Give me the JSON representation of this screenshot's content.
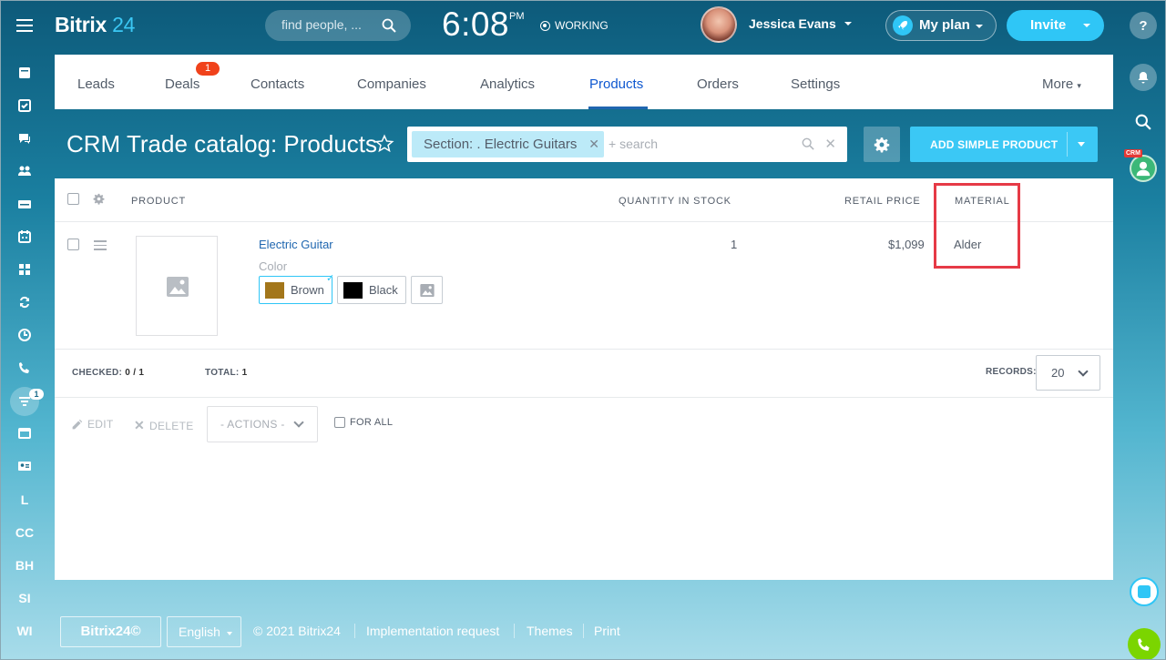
{
  "header": {
    "logo_text": "Bitrix",
    "logo_num": "24",
    "search_placeholder": "find people, ...",
    "time": "6:08",
    "ampm": "PM",
    "status": "WORKING",
    "user_name": "Jessica Evans",
    "myplan_label": "My plan",
    "invite_label": "Invite"
  },
  "left_sidebar": {
    "text_items": [
      "L",
      "CC",
      "BH",
      "SI",
      "WI"
    ],
    "badge": "1"
  },
  "right_sidebar": {
    "help": "?",
    "crm_tag": "CRM"
  },
  "nav": {
    "items": [
      "Leads",
      "Deals",
      "Contacts",
      "Companies",
      "Analytics",
      "Products",
      "Orders",
      "Settings"
    ],
    "active": "Products",
    "deals_badge": "1",
    "more_label": "More"
  },
  "page": {
    "title": "CRM Trade catalog: Products",
    "filter_chip": "Section: . Electric Guitars",
    "filter_placeholder": "+ search",
    "add_button": "ADD SIMPLE PRODUCT"
  },
  "grid": {
    "columns": {
      "product": "PRODUCT",
      "quantity": "QUANTITY IN STOCK",
      "price": "RETAIL PRICE",
      "material": "MATERIAL"
    },
    "rows": [
      {
        "name": "Electric Guitar",
        "color_label": "Color",
        "colors": [
          {
            "name": "Brown",
            "hex": "#a3761a",
            "selected": true
          },
          {
            "name": "Black",
            "hex": "#000000",
            "selected": false
          }
        ],
        "quantity": "1",
        "price": "$1,099",
        "material": "Alder"
      }
    ],
    "checked_label": "CHECKED:",
    "checked_value": "0 / 1",
    "total_label": "TOTAL:",
    "total_value": "1",
    "records_label": "RECORDS:",
    "records_value": "20",
    "edit_label": "EDIT",
    "delete_label": "DELETE",
    "actions_label": "- ACTIONS -",
    "for_all_label": "FOR ALL"
  },
  "footer": {
    "logo": "Bitrix24©",
    "language": "English",
    "copyright": "© 2021 Bitrix24",
    "links": [
      "Implementation request",
      "Themes",
      "Print"
    ]
  },
  "colors": {
    "accent": "#2fc6f6",
    "link": "#2067b0",
    "highlight": "#e63a46",
    "badge": "#f0421b"
  }
}
